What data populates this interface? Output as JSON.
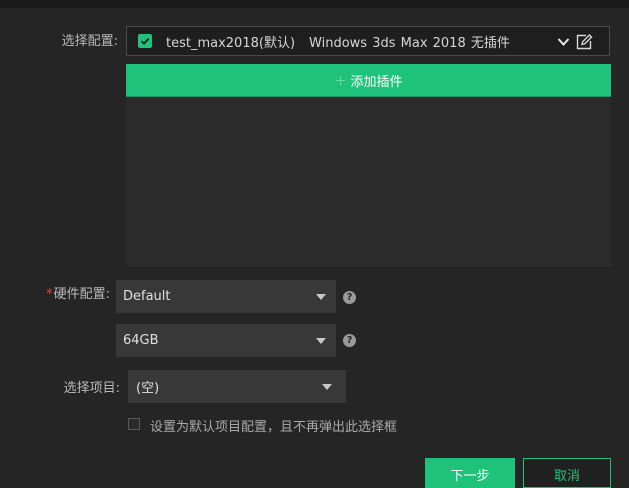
{
  "config": {
    "label": "选择配置:",
    "name": "test_max2018(默认)",
    "os": "Windows",
    "software": "3ds Max 2018",
    "plugins": "无插件",
    "add_plugin_label": "添加插件"
  },
  "hardware": {
    "required_mark": "*",
    "label": "硬件配置:",
    "type_value": "Default",
    "memory_value": "64GB"
  },
  "project": {
    "label": "选择项目:",
    "value": "(空)"
  },
  "default_option": {
    "label": "设置为默认项目配置，且不再弹出此选择框"
  },
  "buttons": {
    "next": "下一步",
    "cancel": "取消"
  },
  "colors": {
    "accent": "#1fc27a",
    "background": "#252525",
    "required": "#e0443a"
  }
}
